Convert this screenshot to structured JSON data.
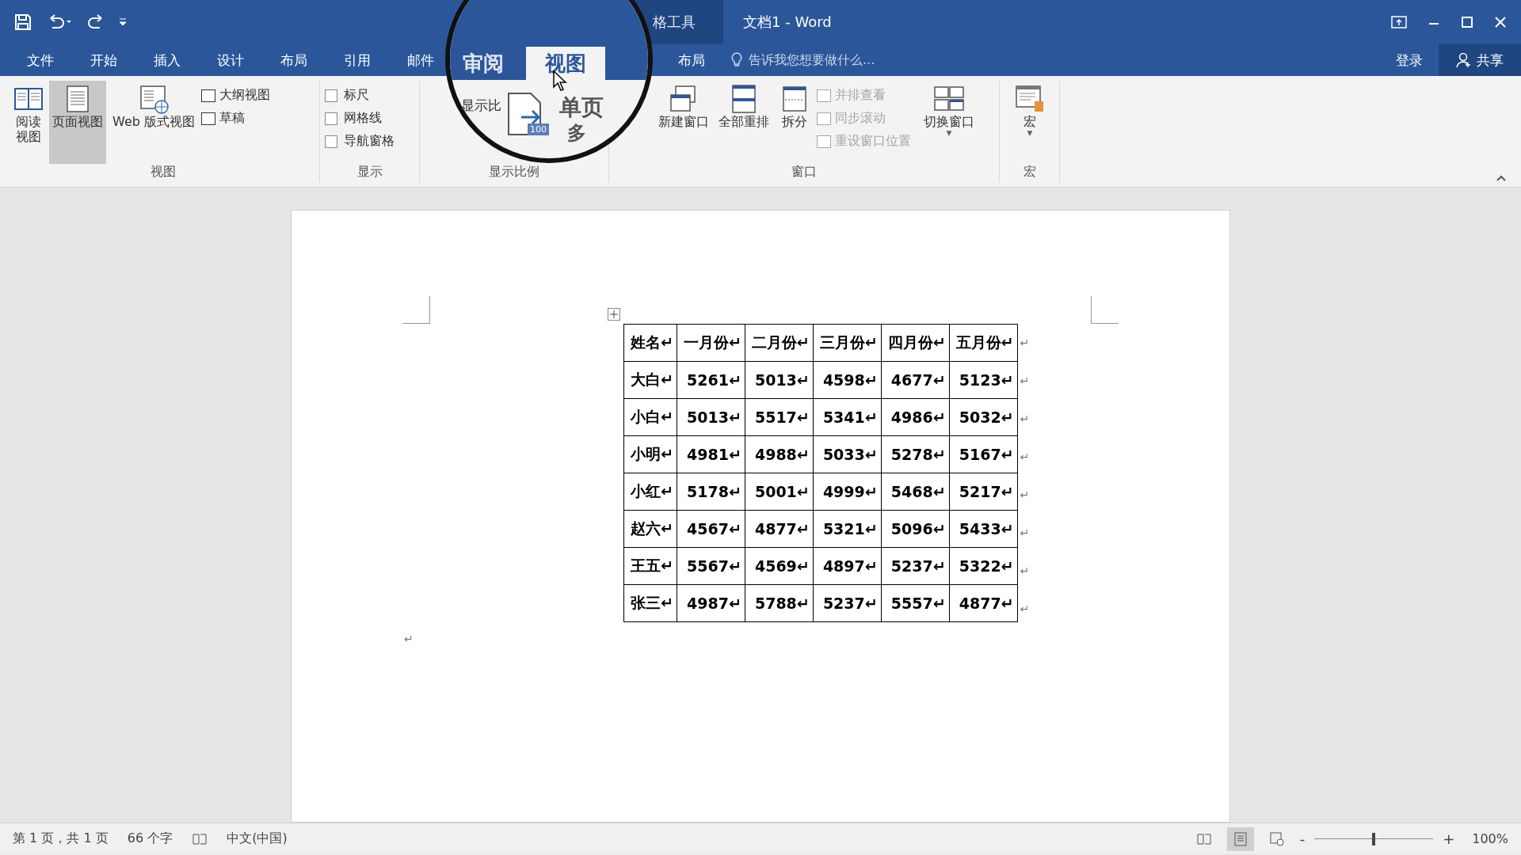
{
  "window": {
    "title": "文档1 - Word",
    "context_tab_group": "格工具"
  },
  "tabs": [
    {
      "label": "文件",
      "selected": false
    },
    {
      "label": "开始",
      "selected": false
    },
    {
      "label": "插入",
      "selected": false
    },
    {
      "label": "设计",
      "selected": false
    },
    {
      "label": "布局",
      "selected": false
    },
    {
      "label": "引用",
      "selected": false
    },
    {
      "label": "邮件",
      "selected": false
    }
  ],
  "context_tabs": [
    {
      "label": "布局",
      "selected": false
    }
  ],
  "tell_me": {
    "placeholder": "告诉我您想要做什么..."
  },
  "account": {
    "sign_in": "登录",
    "share": "共享"
  },
  "ribbon": {
    "groups": [
      {
        "label": "视图",
        "items": [
          {
            "kind": "large",
            "label": "阅读视图",
            "selected": false
          },
          {
            "kind": "large",
            "label": "页面视图",
            "selected": true
          },
          {
            "kind": "large",
            "label": "Web 版式视图",
            "selected": false
          },
          {
            "kind": "stack",
            "items": [
              {
                "label": "大纲视图",
                "disabled": false
              },
              {
                "label": "草稿",
                "disabled": false
              }
            ]
          }
        ]
      },
      {
        "label": "显示",
        "items": [
          {
            "kind": "checks",
            "items": [
              {
                "label": "标尺",
                "checked": false
              },
              {
                "label": "网格线",
                "checked": false
              },
              {
                "label": "导航窗格",
                "checked": false
              }
            ]
          }
        ]
      },
      {
        "label": "显示比例"
      },
      {
        "label": "窗口",
        "items": [
          {
            "kind": "large",
            "label": "新建窗口",
            "selected": false
          },
          {
            "kind": "large",
            "label": "全部重排",
            "selected": false
          },
          {
            "kind": "large",
            "label": "拆分",
            "selected": false
          },
          {
            "kind": "stack",
            "items": [
              {
                "label": "并排查看",
                "disabled": true
              },
              {
                "label": "同步滚动",
                "disabled": true
              },
              {
                "label": "重设窗口位置",
                "disabled": true
              }
            ]
          },
          {
            "kind": "dropdown",
            "label": "切换窗口",
            "caret": "▼"
          }
        ]
      },
      {
        "label": "宏",
        "items": [
          {
            "kind": "dropdown",
            "label": "宏",
            "caret": "▼"
          }
        ]
      }
    ]
  },
  "magnifier": {
    "tabs": [
      {
        "label": "审阅",
        "selected": false
      },
      {
        "label": "视图",
        "selected": true
      }
    ],
    "zoom_label": "显示比",
    "zoom_icon_text": "100",
    "one_page": "单页",
    "multi_page": "多"
  },
  "table": {
    "rows": [
      {
        "cells": [
          "姓名↵",
          "一月份↵",
          "二月份↵",
          "三月份↵",
          "四月份↵",
          "五月份↵"
        ],
        "row_mark": "↵"
      },
      {
        "cells": [
          "大白↵",
          "5261↵",
          "5013↵",
          "4598↵",
          "4677↵",
          "5123↵"
        ],
        "row_mark": "↵"
      },
      {
        "cells": [
          "小白↵",
          "5013↵",
          "5517↵",
          "5341↵",
          "4986↵",
          "5032↵"
        ],
        "row_mark": "↵"
      },
      {
        "cells": [
          "小明↵",
          "4981↵",
          "4988↵",
          "5033↵",
          "5278↵",
          "5167↵"
        ],
        "row_mark": "↵"
      },
      {
        "cells": [
          "小红↵",
          "5178↵",
          "5001↵",
          "4999↵",
          "5468↵",
          "5217↵"
        ],
        "row_mark": "↵"
      },
      {
        "cells": [
          "赵六↵",
          "4567↵",
          "4877↵",
          "5321↵",
          "5096↵",
          "5433↵"
        ],
        "row_mark": "↵"
      },
      {
        "cells": [
          "王五↵",
          "5567↵",
          "4569↵",
          "4897↵",
          "5237↵",
          "5322↵"
        ],
        "row_mark": "↵"
      },
      {
        "cells": [
          "张三↵",
          "4987↵",
          "5788↵",
          "5237↵",
          "5557↵",
          "4877↵"
        ],
        "row_mark": "↵"
      }
    ]
  },
  "paragraph_mark": "↵",
  "status_bar": {
    "page": "第 1 页，共 1 页",
    "words": "66 个字",
    "language": "中文(中国)",
    "zoom_out": "-",
    "zoom_in": "+",
    "zoom": "100%",
    "zoom_level": {
      "level": 0.5
    }
  }
}
